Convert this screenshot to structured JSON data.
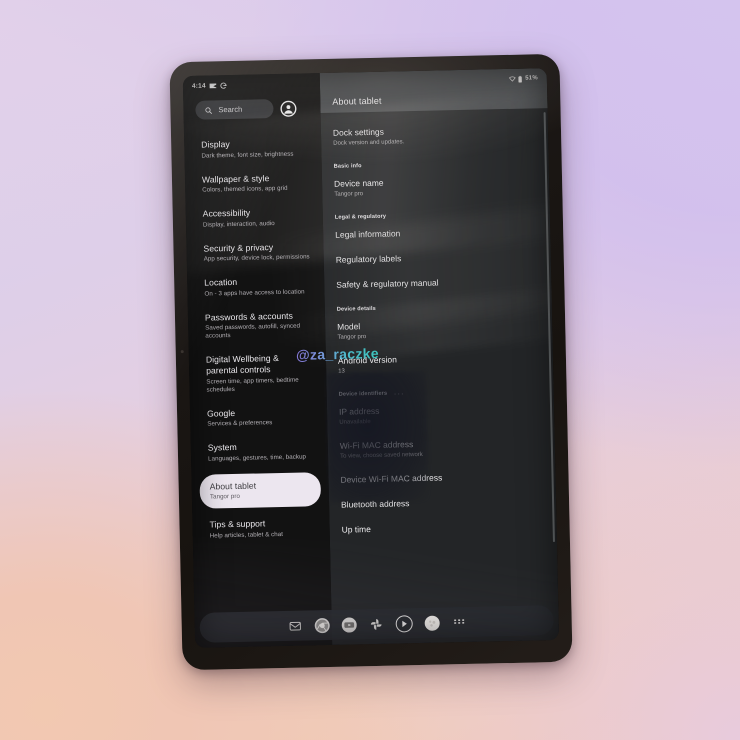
{
  "background": {
    "gradient_from": "#cbb8ef",
    "gradient_to": "#f2c9b1"
  },
  "watermark": {
    "text": "@za_raczke"
  },
  "status_bar": {
    "time": "4:14",
    "icons": [
      "cast-icon",
      "google-g-icon"
    ],
    "wifi_icon": "wifi-icon",
    "battery_icon": "battery-icon",
    "battery_percent": "51%"
  },
  "search": {
    "placeholder": "Search",
    "icon": "search-icon",
    "avatar_icon": "account-avatar-icon"
  },
  "sidebar": {
    "items": [
      {
        "title": "Display",
        "subtitle": "Dark theme, font size, brightness",
        "selected": false
      },
      {
        "title": "Wallpaper & style",
        "subtitle": "Colors, themed icons, app grid",
        "selected": false
      },
      {
        "title": "Accessibility",
        "subtitle": "Display, interaction, audio",
        "selected": false
      },
      {
        "title": "Security & privacy",
        "subtitle": "App security, device lock, permissions",
        "selected": false
      },
      {
        "title": "Location",
        "subtitle": "On - 3 apps have access to location",
        "selected": false
      },
      {
        "title": "Passwords & accounts",
        "subtitle": "Saved passwords, autofill, synced accounts",
        "selected": false
      },
      {
        "title": "Digital Wellbeing & parental controls",
        "subtitle": "Screen time, app timers, bedtime schedules",
        "selected": false
      },
      {
        "title": "Google",
        "subtitle": "Services & preferences",
        "selected": false
      },
      {
        "title": "System",
        "subtitle": "Languages, gestures, time, backup",
        "selected": false
      },
      {
        "title": "About tablet",
        "subtitle": "Tangor pro",
        "selected": true
      },
      {
        "title": "Tips & support",
        "subtitle": "Help articles, tablet & chat",
        "selected": false
      }
    ]
  },
  "detail": {
    "header_title": "About tablet",
    "rows": [
      {
        "kind": "item",
        "title": "Dock settings",
        "subtitle": "Dock version and updates."
      },
      {
        "kind": "section",
        "title": "Basic info"
      },
      {
        "kind": "item",
        "title": "Device name",
        "subtitle": "Tangor pro"
      },
      {
        "kind": "section",
        "title": "Legal & regulatory"
      },
      {
        "kind": "item",
        "title": "Legal information",
        "subtitle": ""
      },
      {
        "kind": "item",
        "title": "Regulatory labels",
        "subtitle": ""
      },
      {
        "kind": "item",
        "title": "Safety & regulatory manual",
        "subtitle": ""
      },
      {
        "kind": "section",
        "title": "Device details"
      },
      {
        "kind": "item",
        "title": "Model",
        "subtitle": "Tangor pro"
      },
      {
        "kind": "item",
        "title": "Android version",
        "subtitle": "13"
      },
      {
        "kind": "section",
        "title": "Device identifiers",
        "dots": "..."
      },
      {
        "kind": "item",
        "title": "IP address",
        "subtitle": "Unavailable"
      },
      {
        "kind": "item",
        "title": "Wi-Fi MAC address",
        "subtitle": "To view, choose saved network"
      },
      {
        "kind": "item",
        "title": "Device Wi-Fi MAC address",
        "subtitle": ""
      },
      {
        "kind": "item",
        "title": "Bluetooth address",
        "subtitle": ""
      },
      {
        "kind": "item",
        "title": "Up time",
        "subtitle": ""
      }
    ]
  },
  "dock": {
    "apps": [
      {
        "name": "gmail-icon",
        "label": "Gmail"
      },
      {
        "name": "chrome-icon",
        "label": "Chrome"
      },
      {
        "name": "youtube-icon",
        "label": "YouTube"
      },
      {
        "name": "photos-icon",
        "label": "Photos"
      },
      {
        "name": "play-store-icon",
        "label": "Play Store"
      },
      {
        "name": "assistant-icon",
        "label": "Assistant"
      },
      {
        "name": "app-drawer-icon",
        "label": "All apps"
      }
    ]
  }
}
